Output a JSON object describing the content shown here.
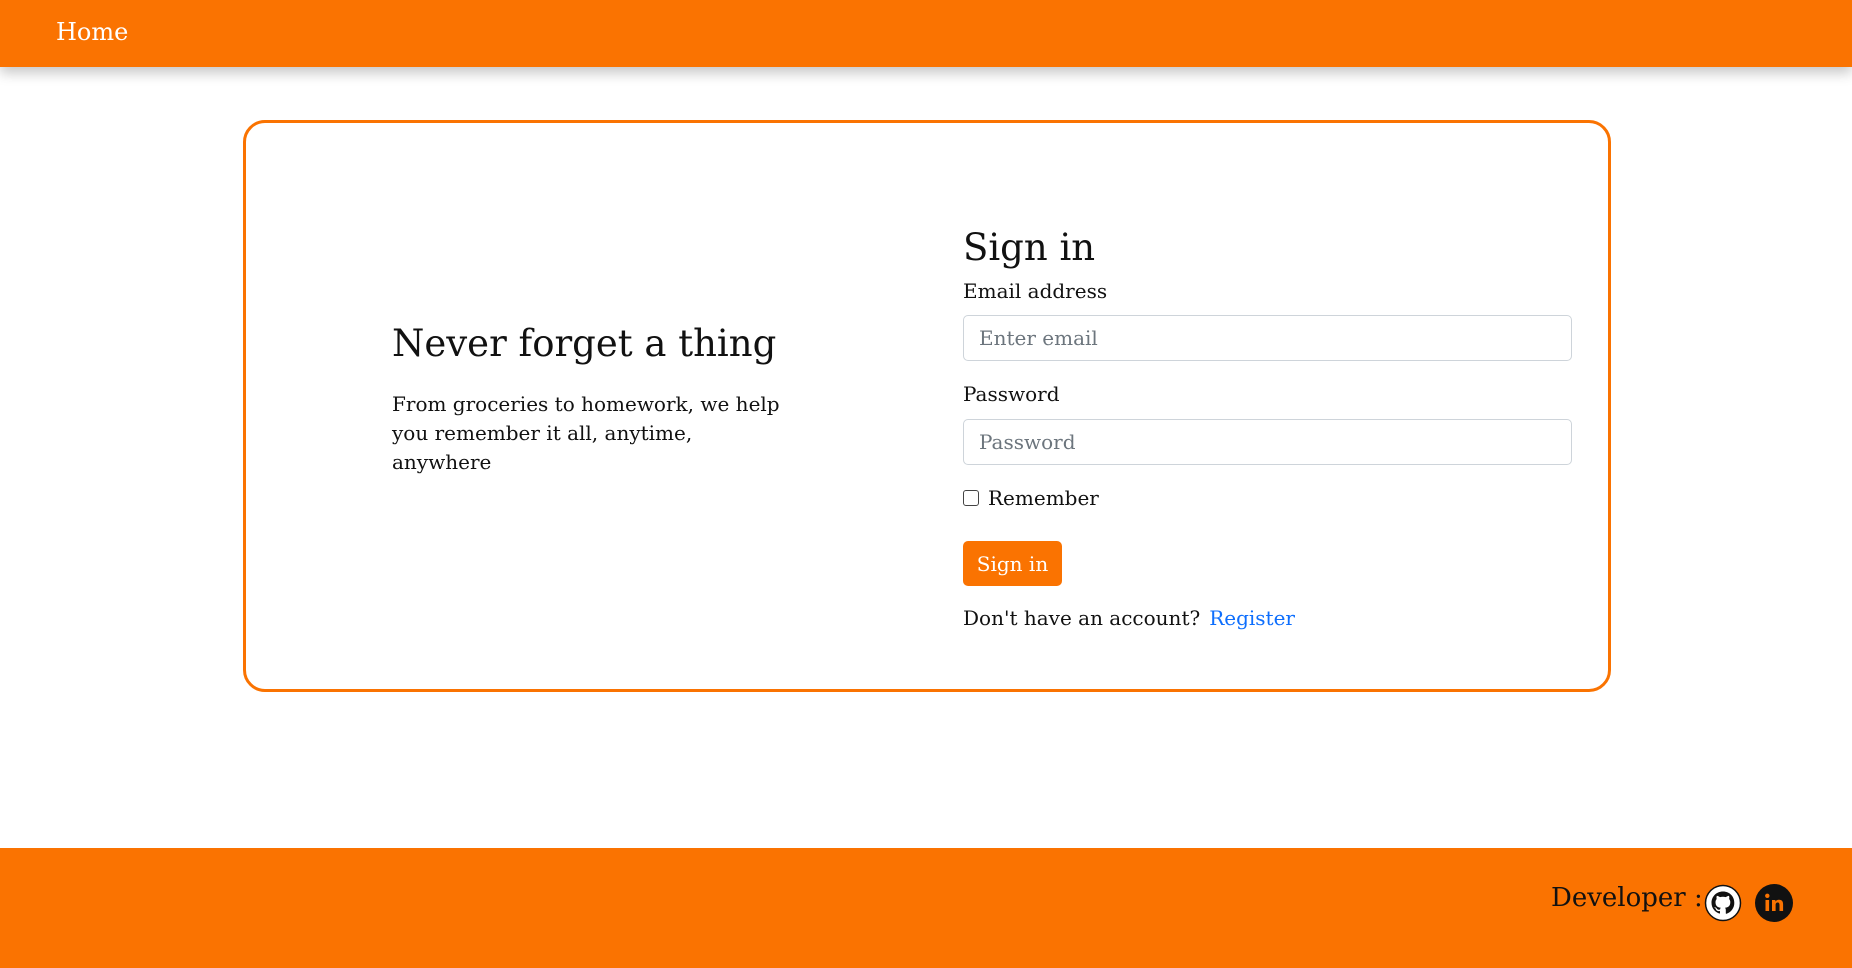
{
  "navbar": {
    "home_label": "Home"
  },
  "hero": {
    "title": "Never forget a thing",
    "text": "From groceries to homework, we help you remember it all, anytime, anywhere"
  },
  "signin": {
    "title": "Sign in",
    "email_label": "Email address",
    "email_placeholder": "Enter email",
    "email_value": "",
    "password_label": "Password",
    "password_placeholder": "Password",
    "password_value": "",
    "remember_label": "Remember",
    "remember_checked": false,
    "button_label": "Sign in",
    "no_account_text": "Don't have an account?",
    "register_label": "Register"
  },
  "footer": {
    "developer_label": "Developer :",
    "icons": [
      "github-icon",
      "linkedin-icon"
    ]
  },
  "colors": {
    "accent": "#fa7301",
    "link": "#0d6efd",
    "input_border": "#ced4da"
  }
}
